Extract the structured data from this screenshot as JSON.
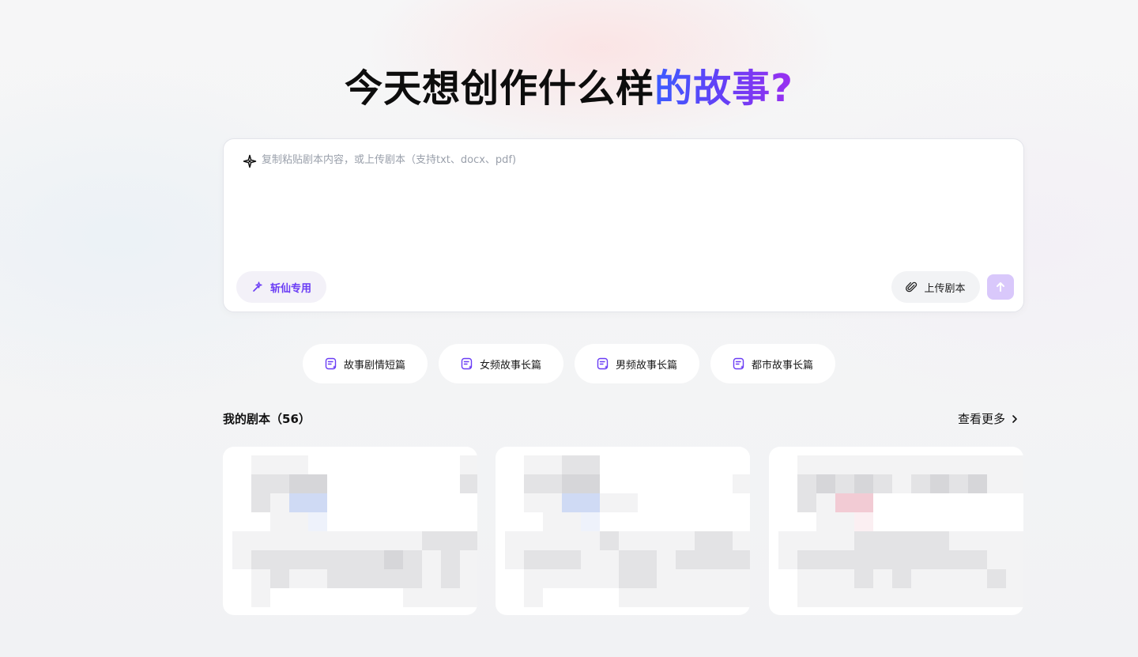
{
  "hero": {
    "title_plain": "今天想创作什么样",
    "title_accent": "的故事?"
  },
  "composer": {
    "placeholder": "复制粘贴剧本内容，或上传剧本（支持txt、docx、pdf)",
    "special_chip_label": "斩仙专用",
    "upload_label": "上传剧本",
    "send_icon": "arrow-up-icon",
    "accent_color": "#6a3cf5",
    "send_bg": "#d9c8fb"
  },
  "templates": [
    {
      "label": "故事剧情短篇",
      "icon": "doc-sparkle-icon"
    },
    {
      "label": "女频故事长篇",
      "icon": "doc-sparkle-icon"
    },
    {
      "label": "男频故事长篇",
      "icon": "doc-sparkle-icon"
    },
    {
      "label": "都市故事长篇",
      "icon": "doc-sparkle-icon"
    }
  ],
  "scripts_section": {
    "title": "我的剧本（56）",
    "see_more_label": "查看更多"
  },
  "cards": [
    {
      "state": "blurred"
    },
    {
      "state": "blurred"
    },
    {
      "state": "blurred"
    }
  ]
}
